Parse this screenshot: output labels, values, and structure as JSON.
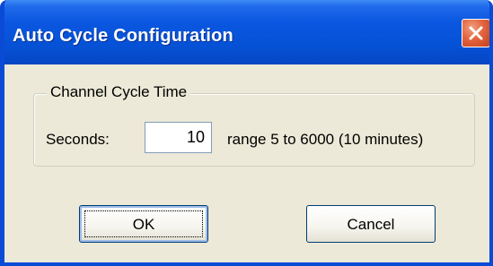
{
  "window": {
    "title": "Auto Cycle Configuration",
    "close_icon": "close-x-icon",
    "accent_color": "#0a4bd6",
    "close_color": "#e3653f"
  },
  "group": {
    "label": "Channel Cycle Time"
  },
  "seconds": {
    "label": "Seconds:",
    "value": "10",
    "range_text": "range 5 to 6000 (10 minutes)"
  },
  "buttons": {
    "ok_label": "OK",
    "cancel_label": "Cancel"
  }
}
